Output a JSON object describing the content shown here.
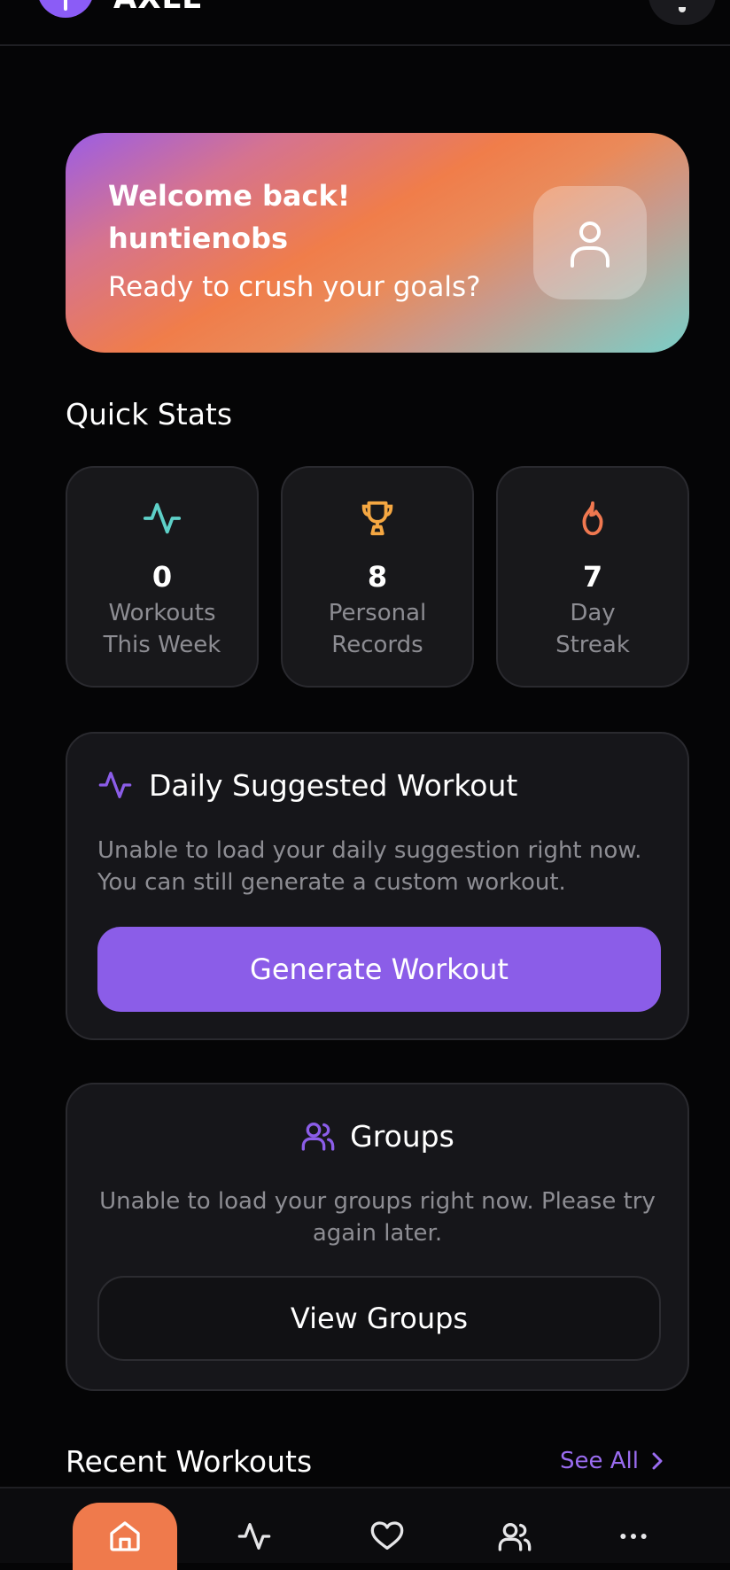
{
  "app": {
    "name": "AXLE"
  },
  "welcome": {
    "title": "Welcome back!",
    "username": "huntienobs",
    "subtitle": "Ready to crush your goals?"
  },
  "quick_stats": {
    "title": "Quick Stats",
    "items": [
      {
        "value": "0",
        "label": "Workouts This Week",
        "icon": "activity-icon",
        "color": "#5ed0c8"
      },
      {
        "value": "8",
        "label": "Personal Records",
        "icon": "trophy-icon",
        "color": "#f5a742"
      },
      {
        "value": "7",
        "label": "Day Streak",
        "icon": "flame-icon",
        "color": "#f07850"
      }
    ]
  },
  "daily": {
    "title": "Daily Suggested Workout",
    "message": "Unable to load your daily suggestion right now. You can still generate a custom workout.",
    "button": "Generate Workout",
    "accent": "#8b5de8"
  },
  "groups": {
    "title": "Groups",
    "message": "Unable to load your groups right now. Please try again later.",
    "button": "View Groups"
  },
  "recent": {
    "title": "Recent Workouts",
    "see_all": "See All"
  },
  "nav": {
    "items": [
      {
        "name": "home",
        "active": true
      },
      {
        "name": "activity",
        "active": false
      },
      {
        "name": "favorites",
        "active": false
      },
      {
        "name": "groups",
        "active": false
      },
      {
        "name": "more",
        "active": false
      }
    ],
    "active_color": "#ef7a4c"
  }
}
